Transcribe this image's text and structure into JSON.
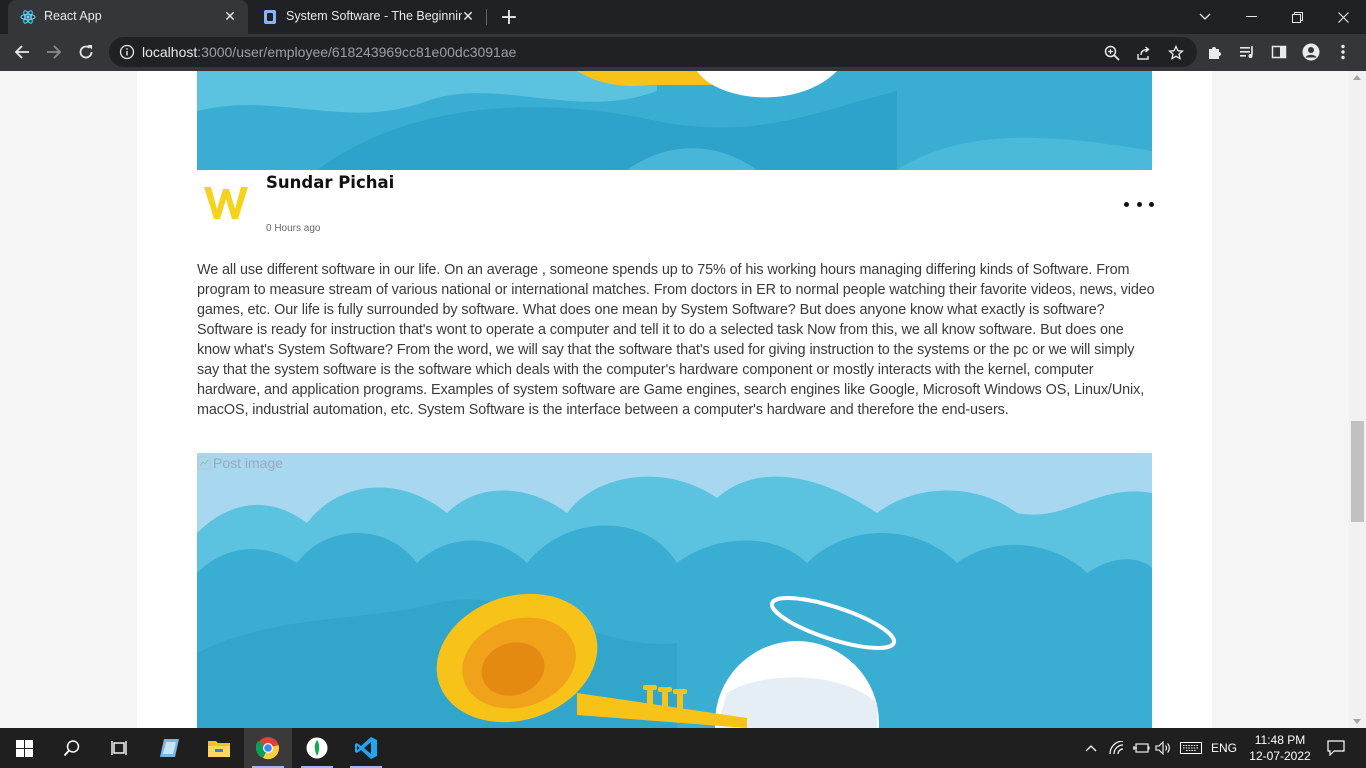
{
  "browser": {
    "tabs": [
      {
        "title": "React App",
        "icon": "react-icon",
        "active": true
      },
      {
        "title": "System Software - The Beginning",
        "icon": "document-icon",
        "active": false
      }
    ],
    "url_host": "localhost",
    "url_rest": ":3000/user/employee/618243969cc81e00dc3091ae"
  },
  "post": {
    "author": "Sundar Pichai",
    "avatar_letter": "W",
    "time": "0 Hours ago",
    "body": "We all use different software in our life. On an average , someone spends up to 75% of his working hours managing differing kinds of Software. From program to measure stream of various national or international matches. From doctors in ER to normal people watching their favorite videos, news, video games, etc. Our life is fully surrounded by software. What does one mean by System Software? But does anyone know what exactly is software? Software is ready for instruction that's wont to operate a computer and tell it to do a selected task Now from this, we all know software. But does one know what's System Software? From the word, we will say that the software that's used for giving instruction to the systems or the pc or we will simply say that the system software is the software which deals with the computer's hardware component or mostly interacts with the kernel, computer hardware, and application programs. Examples of system software are Game engines, search engines like Google, Microsoft Windows OS, Linux/Unix, macOS, industrial automation, etc. System Software is the interface between a computer's hardware and therefore the end-users.",
    "image_alt": "Post image"
  },
  "taskbar": {
    "apps": [
      "windows-start-icon",
      "search-icon",
      "task-view-icon",
      "notepad-icon",
      "file-explorer-icon",
      "chrome-icon",
      "mongodb-compass-icon",
      "vscode-icon"
    ],
    "language": "ENG",
    "time": "11:48 PM",
    "date": "12-07-2022"
  },
  "colors": {
    "avatar": "#f5d21c",
    "sky": "#5bc3e0",
    "cloud_back": "#a8d8f0",
    "cloud_front": "#3aaed2",
    "trumpet": "#f7c319"
  }
}
